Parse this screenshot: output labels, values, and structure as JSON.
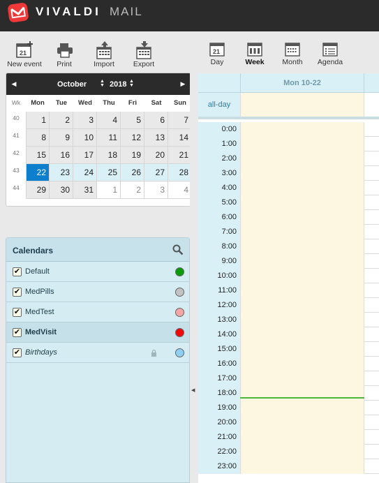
{
  "header": {
    "brand": "VIVALDI",
    "product": "MAIL"
  },
  "toolbar": {
    "new_event": "New event",
    "print": "Print",
    "import": "Import",
    "export": "Export"
  },
  "mini_calendar": {
    "month": "October",
    "year": "2018",
    "week_header": "Wk",
    "day_headers": [
      "Mon",
      "Tue",
      "Wed",
      "Thu",
      "Fri",
      "Sat",
      "Sun"
    ],
    "weeks": [
      {
        "wk": "40",
        "days": [
          "1",
          "2",
          "3",
          "4",
          "5",
          "6",
          "7"
        ]
      },
      {
        "wk": "41",
        "days": [
          "8",
          "9",
          "10",
          "11",
          "12",
          "13",
          "14"
        ]
      },
      {
        "wk": "42",
        "days": [
          "15",
          "16",
          "17",
          "18",
          "19",
          "20",
          "21"
        ]
      },
      {
        "wk": "43",
        "days": [
          "22",
          "23",
          "24",
          "25",
          "26",
          "27",
          "28"
        ]
      },
      {
        "wk": "44",
        "days": [
          "29",
          "30",
          "31",
          "1",
          "2",
          "3",
          "4"
        ]
      }
    ]
  },
  "calendars": {
    "title": "Calendars",
    "items": [
      {
        "name": "Default",
        "color": "#0a9a0a",
        "checked": "✔"
      },
      {
        "name": "MedPills",
        "color": "#c2c2c2",
        "checked": "✔"
      },
      {
        "name": "MedTest",
        "color": "#f4a6a6",
        "checked": "✔"
      },
      {
        "name": "MedVisit",
        "color": "#ee0a0a",
        "checked": "✔"
      },
      {
        "name": "Birthdays",
        "color": "#8ecff2",
        "checked": "✔"
      }
    ]
  },
  "views": {
    "day": "Day",
    "week": "Week",
    "month": "Month",
    "agenda": "Agenda",
    "active": "Week"
  },
  "schedule": {
    "column_date": "Mon 10-22",
    "all_day_label": "all-day",
    "hours": [
      "0:00",
      "1:00",
      "2:00",
      "3:00",
      "4:00",
      "5:00",
      "6:00",
      "7:00",
      "8:00",
      "9:00",
      "10:00",
      "11:00",
      "12:00",
      "13:00",
      "14:00",
      "15:00",
      "16:00",
      "17:00",
      "18:00",
      "19:00",
      "20:00",
      "21:00",
      "22:00",
      "23:00"
    ],
    "current_time_indicator_hour": 18.7
  }
}
